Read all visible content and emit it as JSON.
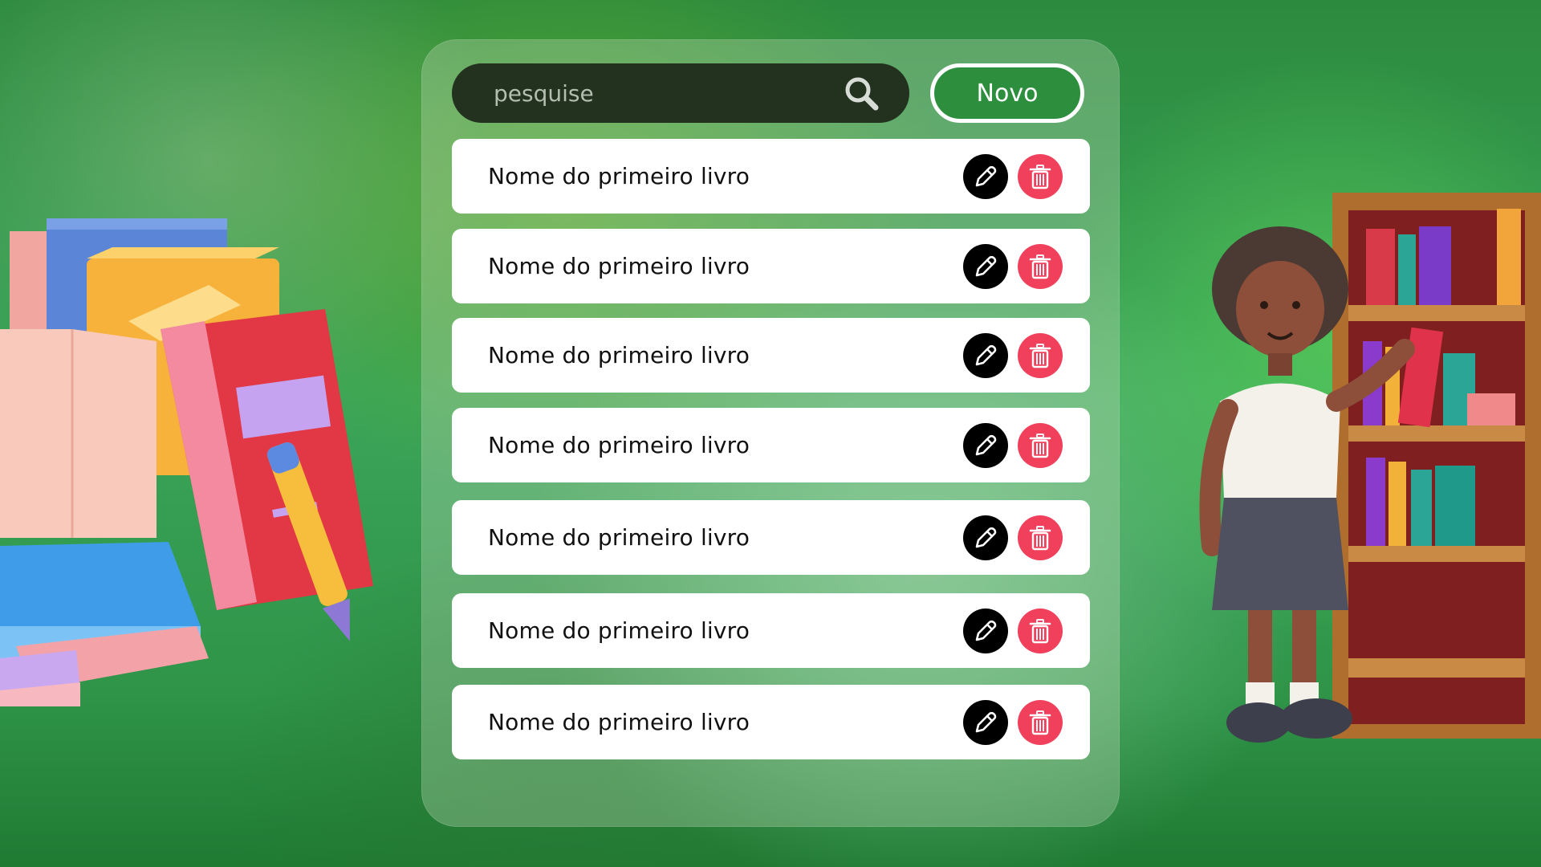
{
  "search": {
    "placeholder": "pesquise"
  },
  "toolbar": {
    "new_label": "Novo"
  },
  "books": [
    {
      "title": "Nome do primeiro livro"
    },
    {
      "title": "Nome do primeiro livro"
    },
    {
      "title": "Nome do primeiro livro"
    },
    {
      "title": "Nome do primeiro livro"
    },
    {
      "title": "Nome do primeiro livro"
    },
    {
      "title": "Nome do primeiro livro"
    },
    {
      "title": "Nome do primeiro livro"
    }
  ],
  "icons": {
    "search": "search-icon",
    "edit": "pencil-icon",
    "delete": "trash-icon"
  },
  "colors": {
    "panel_bg": "#c8dcbe",
    "search_bg": "#22321f",
    "row_bg": "#ffffff",
    "edit_bg": "#000000",
    "delete_bg": "#f0405c",
    "new_button_border": "#ffffff"
  }
}
